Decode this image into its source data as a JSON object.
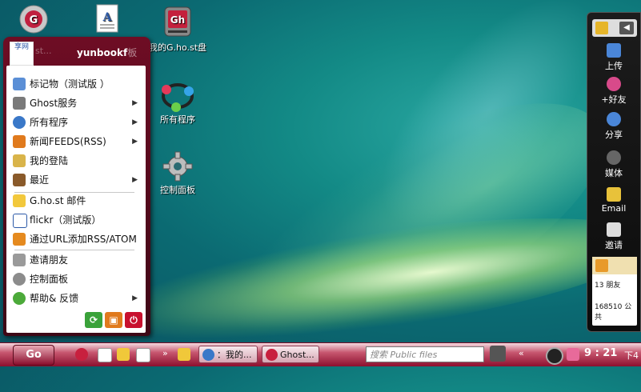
{
  "desktop": {
    "icons": [
      {
        "label": "我的G.ho.st盘",
        "name": "my-ghost-drive"
      },
      {
        "label": "所有程序",
        "name": "all-programs"
      },
      {
        "label": "控制面板",
        "name": "control-panel"
      }
    ],
    "top_icon_label_fragment": "st..."
  },
  "start_menu": {
    "username": "yunbookf",
    "username_suffix": "板",
    "avatar_text": "享网",
    "items": [
      {
        "label": "标记物（测试版 ）",
        "submenu": false
      },
      {
        "label": "Ghost服务",
        "submenu": true
      },
      {
        "label": "所有程序",
        "submenu": true
      },
      {
        "label": "新闻FEEDS(RSS)",
        "submenu": true
      },
      {
        "label": "我的登陆",
        "submenu": false
      },
      {
        "label": "最近",
        "submenu": true
      },
      {
        "label": "G.ho.st 邮件",
        "submenu": false
      },
      {
        "label": "flickr（测试版）",
        "submenu": false
      },
      {
        "label": "通过URL添加RSS/ATOM",
        "submenu": false
      },
      {
        "label": "邀请朋友",
        "submenu": false
      },
      {
        "label": "控制面板",
        "submenu": false
      },
      {
        "label": "帮助& 反馈",
        "submenu": true
      }
    ],
    "submenu_arrow": "▶"
  },
  "right_panel": {
    "items": [
      {
        "label": "上传"
      },
      {
        "label": "+好友"
      },
      {
        "label": "分享"
      },
      {
        "label": "媒体"
      },
      {
        "label": "Email"
      },
      {
        "label": "邀请"
      }
    ],
    "friends_text": "13 朋友",
    "public_text": "168510 公共"
  },
  "taskbar": {
    "go_label": "Go",
    "tasks": [
      {
        "label": "：我的..."
      },
      {
        "label": "Ghost..."
      }
    ],
    "search_placeholder": "搜索  Public files",
    "clock": "9 : 21",
    "ampm": "下4",
    "overflow": "»",
    "left_arrow": "«"
  },
  "colors": {
    "menu_header": "#6e0d24",
    "taskbar": "#8c0f2e",
    "desktop": "#138a86"
  }
}
